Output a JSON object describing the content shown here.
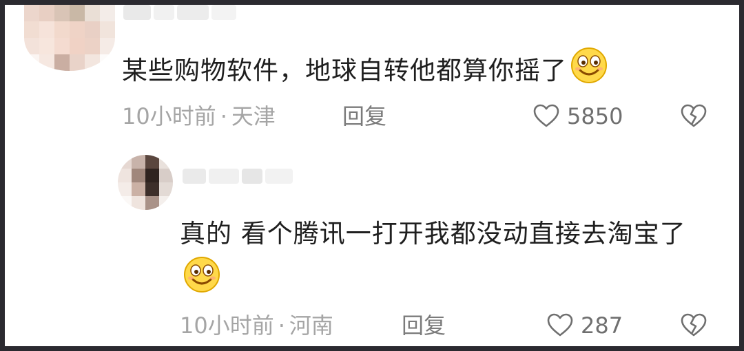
{
  "colors": {
    "frame": "#2b2a30",
    "panel_bg": "#ffffff",
    "text_primary": "#1f1f1f",
    "text_meta": "#a5a5a5",
    "icon": "#6f6f6f"
  },
  "comments": [
    {
      "avatar_icon": "user-avatar-pixelated",
      "text": "某些购物软件，地球自转他都算你摇了",
      "emoji_icon": "smiling-face-emoji",
      "time": "10小时前",
      "separator": "·",
      "location": "天津",
      "reply_label": "回复",
      "likes": "5850",
      "like_icon": "heart-outline-icon",
      "dislike_icon": "broken-heart-icon"
    }
  ],
  "replies": [
    {
      "avatar_icon": "user-avatar-pixelated",
      "text": "真的 看个腾讯一打开我都没动直接去淘宝了",
      "emoji_icon": "smiling-face-emoji",
      "time": "10小时前",
      "separator": "·",
      "location": "河南",
      "reply_label": "回复",
      "likes": "287",
      "like_icon": "heart-outline-icon",
      "dislike_icon": "broken-heart-icon"
    }
  ]
}
